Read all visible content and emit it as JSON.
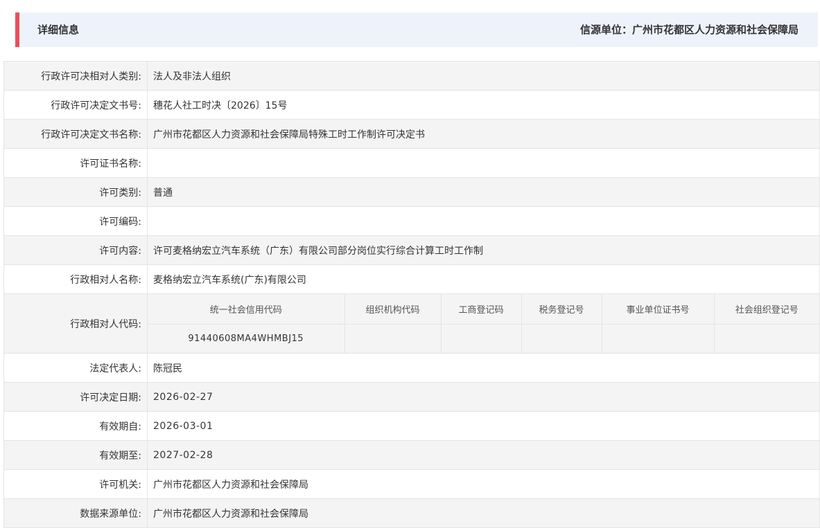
{
  "header": {
    "title": "详细信息",
    "source": "信源单位：广州市花都区人力资源和社会保障局"
  },
  "rows": [
    {
      "label": "行政许可决相对人类别:",
      "value": "法人及非法人组织"
    },
    {
      "label": "行政许可决定文书号:",
      "value": "穗花人社工时决〔2026〕15号"
    },
    {
      "label": "行政许可决定文书名称:",
      "value": "广州市花都区人力资源和社会保障局特殊工时工作制许可决定书"
    },
    {
      "label": "许可证书名称:",
      "value": ""
    },
    {
      "label": "许可类别:",
      "value": "普通"
    },
    {
      "label": "许可编码:",
      "value": ""
    },
    {
      "label": "许可内容:",
      "value": "许可麦格纳宏立汽车系统（广东）有限公司部分岗位实行综合计算工时工作制"
    },
    {
      "label": "行政相对人名称:",
      "value": "麦格纳宏立汽车系统(广东)有限公司"
    }
  ],
  "code_row": {
    "label": "行政相对人代码:",
    "headers": [
      "统一社会信用代码",
      "组织机构代码",
      "工商登记码",
      "税务登记号",
      "事业单位证书号",
      "社会组织登记号"
    ],
    "values": [
      "91440608MA4WHMBJ15",
      "",
      "",
      "",
      "",
      ""
    ]
  },
  "rows_after": [
    {
      "label": "法定代表人:",
      "value": "陈冠民"
    },
    {
      "label": "许可决定日期:",
      "value": "2026-02-27"
    },
    {
      "label": "有效期自:",
      "value": "2026-03-01"
    },
    {
      "label": "有效期至:",
      "value": "2027-02-28"
    },
    {
      "label": "许可机关:",
      "value": "广州市花都区人力资源和社会保障局"
    },
    {
      "label": "数据来源单位:",
      "value": "广州市花都区人力资源和社会保障局"
    }
  ],
  "colors": {
    "accent": "#e8515a",
    "header_bg": "#eef3fb",
    "row_alt": "#f4f4f4",
    "border": "#e4e4e4"
  }
}
